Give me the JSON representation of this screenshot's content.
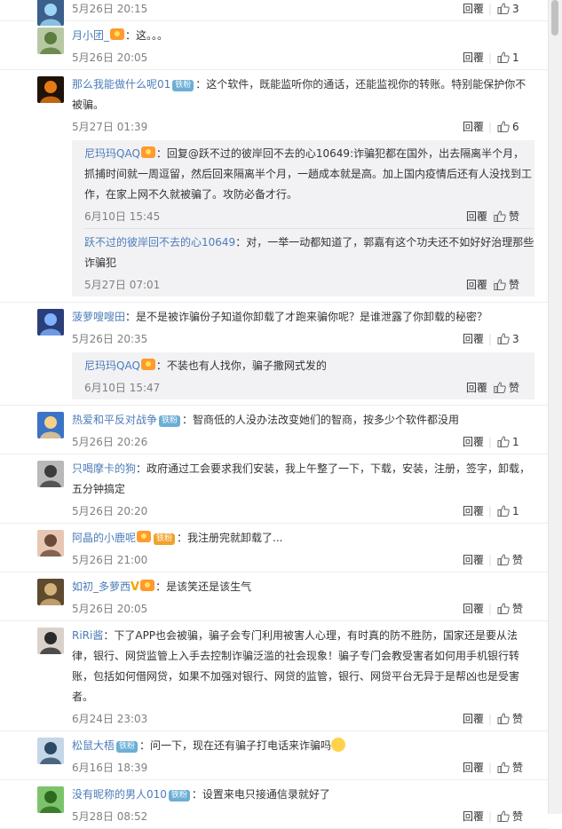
{
  "like_zero_label": "赞",
  "comments": [
    {
      "id": "c0",
      "avatar": {
        "bg": "#3c5f8c",
        "fg": "#9dd7f5"
      },
      "name": "",
      "badge": "",
      "text": "",
      "time": "5月26日 20:15",
      "reply": "回覆",
      "likes": "3",
      "height": 40
    },
    {
      "id": "c1",
      "avatar": {
        "bg": "#b7c9a4",
        "fg": "#5a7c3c"
      },
      "name": "月小团_",
      "medal": true,
      "text": "：这。。。",
      "time": "5月26日 20:05",
      "reply": "回覆",
      "likes": "1"
    },
    {
      "id": "c2",
      "avatar": {
        "bg": "#1f1208",
        "fg": "#e87a14"
      },
      "name": "那么我能做什么呢01",
      "badge": "铁粉",
      "text": "：这个软件，既能监听你的通话，还能监视你的转账。特别能保护你不被骗。",
      "time": "5月27日 01:39",
      "reply": "回覆",
      "likes": "6",
      "subs": [
        {
          "name": "尼玛玛QAQ",
          "medal": true,
          "text": "：回复@跃不过的彼岸回不去的心10649:诈骗犯都在国外，出去隔离半个月，抓捕时间就一周逗留，然后回来隔离半个月，一趟成本就是高。加上国内疫情后还有人没找到工作，在家上网不久就被骗了。攻防必备才行。",
          "time": "6月10日 15:45",
          "reply": "回覆",
          "likes": ""
        },
        {
          "name": "跃不过的彼岸回不去的心10649",
          "text": "：对，一举一动都知道了，郭嘉有这个功夫还不如好好治理那些诈骗犯",
          "time": "5月27日 07:01",
          "reply": "回覆",
          "likes": ""
        }
      ]
    },
    {
      "id": "c3",
      "avatar": {
        "bg": "#2a3e7a",
        "fg": "#7fb2ff"
      },
      "name": "菠萝嗖嗖田",
      "text": "：是不是被诈骗份子知道你卸载了才跑来骗你呢？是谁泄露了你卸载的秘密？",
      "time": "5月26日 20:35",
      "reply": "回覆",
      "likes": "3",
      "subs": [
        {
          "name": "尼玛玛QAQ",
          "medal": true,
          "text": "：不装也有人找你，骗子撒网式发的",
          "time": "6月10日 15:47",
          "reply": "回覆",
          "likes": ""
        }
      ]
    },
    {
      "id": "c4",
      "avatar": {
        "bg": "#3b74c7",
        "fg": "#f7d08a"
      },
      "name": "热爱和平反对战争",
      "badge": "铁粉",
      "text": "：智商低的人没办法改变她们的智商，按多少个软件都没用",
      "time": "5月26日 20:26",
      "reply": "回覆",
      "likes": "1"
    },
    {
      "id": "c5",
      "avatar": {
        "bg": "#b9b9b9",
        "fg": "#3b3b3b"
      },
      "name": "只喝摩卡的狗",
      "text": "：政府通过工会要求我们安装，我上午整了一下，下载，安装，注册，签字，卸载，五分钟搞定",
      "time": "5月26日 20:20",
      "reply": "回覆",
      "likes": "1"
    },
    {
      "id": "c6",
      "avatar": {
        "bg": "#e7c7b4",
        "fg": "#6b4a3a"
      },
      "name": "阿晶的小鹿呢",
      "medal": true,
      "badge": "铁粉",
      "badge_orange": true,
      "text": "：我注册完就卸载了...",
      "time": "5月26日 21:00",
      "reply": "回覆",
      "likes": ""
    },
    {
      "id": "c7",
      "avatar": {
        "bg": "#5e4a2e",
        "fg": "#d5b27c"
      },
      "name": "如初_多萝西",
      "vmark": "V",
      "medal": true,
      "text": "：是该笑还是该生气",
      "time": "5月26日 20:05",
      "reply": "回覆",
      "likes": ""
    },
    {
      "id": "c8",
      "avatar": {
        "bg": "#d9d2cc",
        "fg": "#2a2a2a"
      },
      "name": "RiRi酱",
      "text": "：下了APP也会被骗，骗子会专门利用被害人心理，有时真的防不胜防，国家还是要从法律，银行、网贷监管上入手去控制诈骗泛滥的社会现象！骗子专门会教受害者如何用手机银行转账，包括如何借网贷，如果不加强对银行、网贷的监管，银行、网贷平台无异于是帮凶也是受害者。",
      "time": "6月24日 23:03",
      "reply": "回覆",
      "likes": ""
    },
    {
      "id": "c9",
      "avatar": {
        "bg": "#c5d7e6",
        "fg": "#2b4a66"
      },
      "name": "松鼠大梧",
      "badge": "铁粉",
      "text": "：问一下，现在还有骗子打电话来诈骗吗",
      "emoji": true,
      "time": "6月16日 18:39",
      "reply": "回覆",
      "likes": ""
    },
    {
      "id": "c10",
      "avatar": {
        "bg": "#7cc46b",
        "fg": "#2d6a1e"
      },
      "name": "没有昵称的男人010",
      "badge": "铁粉",
      "text": "：设置来电只接通信录就好了",
      "time": "5月28日 08:52",
      "reply": "回覆",
      "likes": ""
    }
  ]
}
